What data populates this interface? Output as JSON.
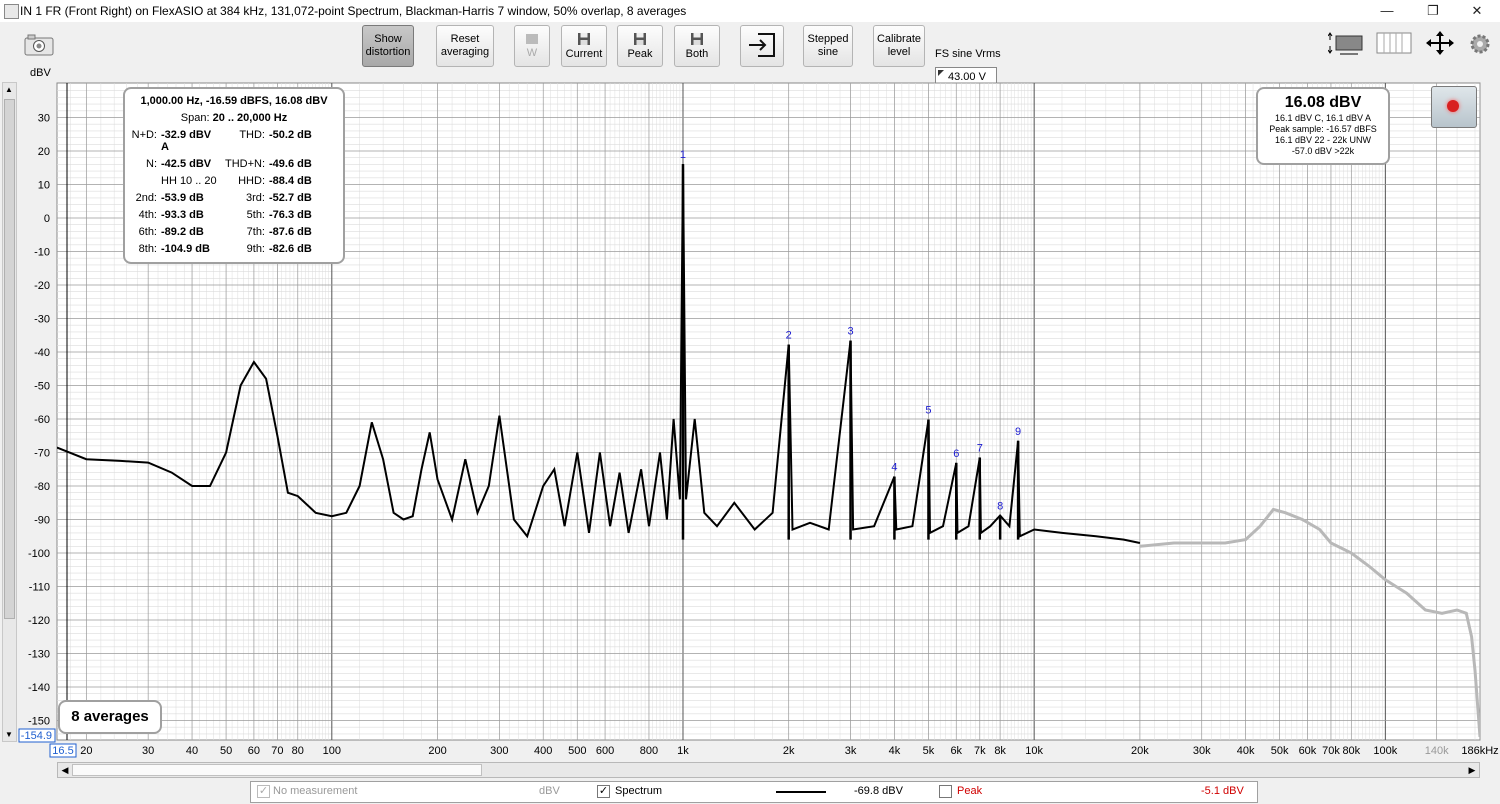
{
  "window": {
    "title": "IN 1 FR (Front Right) on FlexASIO at 384 kHz, 131,072-point Spectrum, Blackman-Harris 7 window, 50% overlap, 8 averages",
    "minimize": "—",
    "restore": "❐",
    "close": "✕"
  },
  "toolbar": {
    "show_distortion": [
      "Show",
      "distortion"
    ],
    "reset_averaging": [
      "Reset",
      "averaging"
    ],
    "w_label": "W",
    "current_label": "Current",
    "peak_label": "Peak",
    "both_label": "Both",
    "stepped_sine": [
      "Stepped",
      "sine"
    ],
    "calibrate_level": [
      "Calibrate",
      "level"
    ],
    "fs_label": "FS sine Vrms",
    "fs_value": "43.00 V"
  },
  "distortion": {
    "header": "1,000.00 Hz, -16.59 dBFS, 16.08 dBV",
    "span_label": "Span:",
    "span_value": "20 .. 20,000 Hz",
    "rows": [
      [
        "N+D:",
        "-32.9 dBV A",
        "THD:",
        "-50.2 dB"
      ],
      [
        "N:",
        "-42.5 dBV",
        "THD+N:",
        "-49.6 dB"
      ],
      [
        "",
        "HH 10 .. 20",
        "HHD:",
        "-88.4 dB"
      ],
      [
        "2nd:",
        "-53.9 dB",
        "3rd:",
        "-52.7 dB"
      ],
      [
        "4th:",
        "-93.3 dB",
        "5th:",
        "-76.3 dB"
      ],
      [
        "6th:",
        "-89.2 dB",
        "7th:",
        "-87.6 dB"
      ],
      [
        "8th:",
        "-104.9 dB",
        "9th:",
        "-82.6 dB"
      ]
    ]
  },
  "level": {
    "main": "16.08 dBV",
    "lines": [
      "16.1 dBV C, 16.1 dBV A",
      "Peak sample: -16.57 dBFS",
      "16.1 dBV 22 - 22k UNW",
      "-57.0 dBV >22k"
    ]
  },
  "averages": "8 averages",
  "legend": {
    "no_measurement": "No measurement",
    "no_measurement_unit": "dBV",
    "spectrum": "Spectrum",
    "spectrum_value": "-69.8 dBV",
    "peak": "Peak",
    "peak_value": "-5.1 dBV",
    "spectrum_checked": "✓",
    "nm_checked": "✓"
  },
  "colors": {
    "spectrum": "#000000",
    "above_20k": "#b8b8b8",
    "harmonic_label": "#1a1ad0",
    "peak": "#d00000",
    "grid_major": "#9a9a9a",
    "grid_minor": "#dcdcdc"
  },
  "chart_data": {
    "type": "line",
    "ylabel": "dBV",
    "xscale": "log",
    "xlim": [
      16.5,
      186000
    ],
    "ylim": [
      -154.9,
      40
    ],
    "y_ticks": [
      30,
      20,
      10,
      0,
      -10,
      -20,
      -30,
      -40,
      -50,
      -60,
      -70,
      -80,
      -90,
      -100,
      -110,
      -120,
      -130,
      -140,
      -150
    ],
    "x_ticks": [
      {
        "v": 20,
        "l": "20"
      },
      {
        "v": 30,
        "l": "30"
      },
      {
        "v": 40,
        "l": "40"
      },
      {
        "v": 50,
        "l": "50"
      },
      {
        "v": 60,
        "l": "60"
      },
      {
        "v": 70,
        "l": "70"
      },
      {
        "v": 80,
        "l": "80"
      },
      {
        "v": 100,
        "l": "100"
      },
      {
        "v": 200,
        "l": "200"
      },
      {
        "v": 300,
        "l": "300"
      },
      {
        "v": 400,
        "l": "400"
      },
      {
        "v": 500,
        "l": "500"
      },
      {
        "v": 600,
        "l": "600"
      },
      {
        "v": 800,
        "l": "800"
      },
      {
        "v": 1000,
        "l": "1k"
      },
      {
        "v": 2000,
        "l": "2k"
      },
      {
        "v": 3000,
        "l": "3k"
      },
      {
        "v": 4000,
        "l": "4k"
      },
      {
        "v": 5000,
        "l": "5k"
      },
      {
        "v": 6000,
        "l": "6k"
      },
      {
        "v": 7000,
        "l": "7k"
      },
      {
        "v": 8000,
        "l": "8k"
      },
      {
        "v": 10000,
        "l": "10k"
      },
      {
        "v": 20000,
        "l": "20k"
      },
      {
        "v": 30000,
        "l": "30k"
      },
      {
        "v": 40000,
        "l": "40k"
      },
      {
        "v": 50000,
        "l": "50k"
      },
      {
        "v": 60000,
        "l": "60k"
      },
      {
        "v": 70000,
        "l": "70k"
      },
      {
        "v": 80000,
        "l": "80k"
      },
      {
        "v": 100000,
        "l": "100k"
      },
      {
        "v": 140000,
        "l": "140k"
      },
      {
        "v": 186000,
        "l": "186kHz"
      }
    ],
    "x_start_label": "16.5",
    "y_bottom_label": "-154.9",
    "harmonics": [
      {
        "n": "1",
        "f": 1000,
        "db": 16.08
      },
      {
        "n": "2",
        "f": 2000,
        "db": -37.8
      },
      {
        "n": "3",
        "f": 3000,
        "db": -36.6
      },
      {
        "n": "4",
        "f": 4000,
        "db": -77.2
      },
      {
        "n": "5",
        "f": 5000,
        "db": -60.2
      },
      {
        "n": "6",
        "f": 6000,
        "db": -73.1
      },
      {
        "n": "7",
        "f": 7000,
        "db": -71.5
      },
      {
        "n": "8",
        "f": 8000,
        "db": -88.8
      },
      {
        "n": "9",
        "f": 9000,
        "db": -66.5
      }
    ],
    "series": [
      {
        "name": "Spectrum",
        "points": [
          [
            16.5,
            -68.5
          ],
          [
            20,
            -72
          ],
          [
            25,
            -72.5
          ],
          [
            30,
            -73
          ],
          [
            35,
            -76
          ],
          [
            40,
            -80
          ],
          [
            45,
            -80
          ],
          [
            50,
            -70
          ],
          [
            55,
            -50
          ],
          [
            60,
            -43
          ],
          [
            65,
            -48
          ],
          [
            70,
            -65
          ],
          [
            75,
            -82
          ],
          [
            80,
            -83
          ],
          [
            90,
            -88
          ],
          [
            100,
            -89
          ],
          [
            110,
            -88
          ],
          [
            120,
            -80
          ],
          [
            130,
            -61
          ],
          [
            140,
            -72
          ],
          [
            150,
            -88
          ],
          [
            160,
            -90
          ],
          [
            170,
            -89
          ],
          [
            180,
            -75
          ],
          [
            190,
            -64
          ],
          [
            200,
            -78
          ],
          [
            220,
            -90
          ],
          [
            240,
            -72
          ],
          [
            260,
            -88
          ],
          [
            280,
            -80
          ],
          [
            300,
            -59
          ],
          [
            330,
            -90
          ],
          [
            360,
            -95
          ],
          [
            400,
            -80
          ],
          [
            430,
            -75
          ],
          [
            460,
            -92
          ],
          [
            500,
            -70
          ],
          [
            540,
            -94
          ],
          [
            580,
            -70
          ],
          [
            620,
            -92
          ],
          [
            660,
            -76
          ],
          [
            700,
            -94
          ],
          [
            760,
            -75
          ],
          [
            800,
            -92
          ],
          [
            860,
            -70
          ],
          [
            900,
            -90
          ],
          [
            940,
            -60
          ],
          [
            980,
            -84
          ],
          [
            1000,
            16.08
          ],
          [
            1020,
            -84
          ],
          [
            1080,
            -60
          ],
          [
            1150,
            -88
          ],
          [
            1250,
            -92
          ],
          [
            1400,
            -85
          ],
          [
            1600,
            -93
          ],
          [
            1800,
            -88
          ],
          [
            2000,
            -37.8
          ],
          [
            2050,
            -93
          ],
          [
            2300,
            -91
          ],
          [
            2600,
            -93
          ],
          [
            3000,
            -36.6
          ],
          [
            3050,
            -93
          ],
          [
            3500,
            -92
          ],
          [
            4000,
            -77.2
          ],
          [
            4050,
            -93
          ],
          [
            4500,
            -92
          ],
          [
            5000,
            -60.2
          ],
          [
            5050,
            -94
          ],
          [
            5500,
            -92
          ],
          [
            6000,
            -73.1
          ],
          [
            6050,
            -94
          ],
          [
            6500,
            -92
          ],
          [
            7000,
            -71.5
          ],
          [
            7050,
            -94
          ],
          [
            7500,
            -92
          ],
          [
            8000,
            -88.8
          ],
          [
            8500,
            -92
          ],
          [
            9000,
            -66.5
          ],
          [
            9100,
            -95
          ],
          [
            10000,
            -93
          ],
          [
            12000,
            -94
          ],
          [
            15000,
            -95
          ],
          [
            18000,
            -96
          ],
          [
            20000,
            -97
          ]
        ]
      },
      {
        "name": "Above 20 kHz",
        "points": [
          [
            20000,
            -98
          ],
          [
            25000,
            -97
          ],
          [
            30000,
            -97
          ],
          [
            35000,
            -97
          ],
          [
            40000,
            -96
          ],
          [
            44000,
            -92
          ],
          [
            48000,
            -87
          ],
          [
            52000,
            -88
          ],
          [
            58000,
            -90
          ],
          [
            65000,
            -93
          ],
          [
            70000,
            -97
          ],
          [
            80000,
            -100
          ],
          [
            90000,
            -104
          ],
          [
            100000,
            -108
          ],
          [
            115000,
            -112
          ],
          [
            130000,
            -117
          ],
          [
            145000,
            -118
          ],
          [
            160000,
            -117
          ],
          [
            170000,
            -118
          ],
          [
            176000,
            -125
          ],
          [
            180000,
            -135
          ],
          [
            183000,
            -145
          ],
          [
            186000,
            -154.9
          ]
        ]
      }
    ]
  }
}
